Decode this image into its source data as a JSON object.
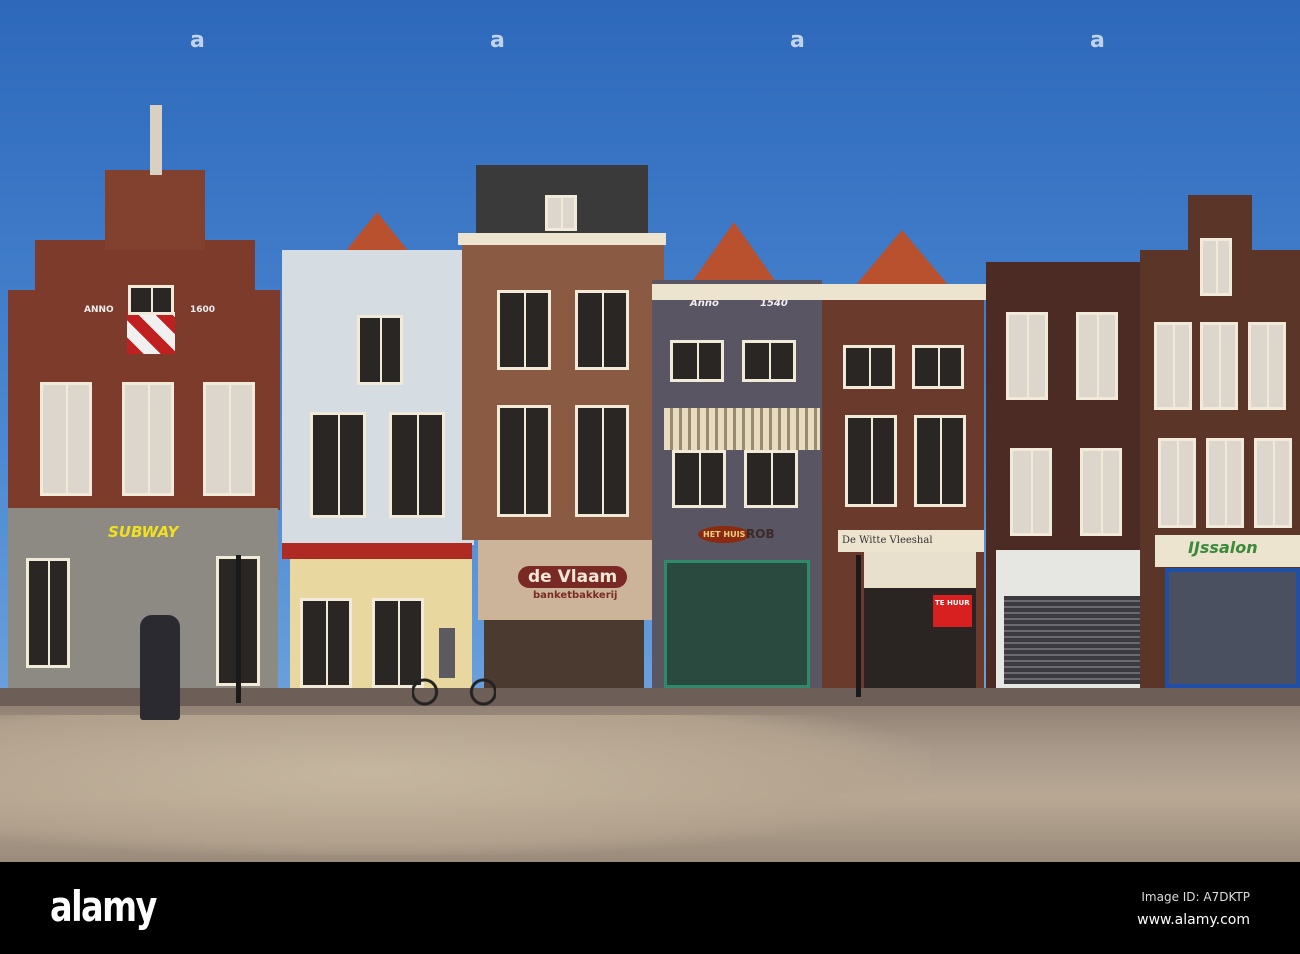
{
  "photo": {
    "signs": {
      "anno_left": "ANNO",
      "year_left": "1600",
      "subway": "SUBWAY",
      "bakery_name": "de Vlaam",
      "bakery_sub": "banketbakkerij",
      "het_huis": "HET HUIS",
      "rob_sign": "ROB",
      "anno_right": "Anno",
      "year_right": "1540",
      "vleeshal": "De Witte Vleeshal",
      "te_huur": "TE HUUR",
      "ice_cream": "IJssalon"
    },
    "colors": {
      "sky": "#2d68bb",
      "brick": "#7a3a2a",
      "awning_red": "#b02a24",
      "storefront_blue": "#1f4fa8"
    }
  },
  "watermark": {
    "logo": "alamy",
    "image_id": "Image ID: A7DKTP",
    "url": "www.alamy.com"
  }
}
